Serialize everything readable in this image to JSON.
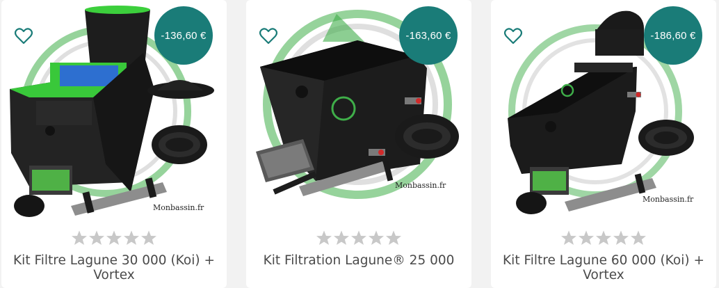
{
  "products": [
    {
      "title": "Kit Filtre Lagune 30 000 (Koi) + Vortex",
      "discount": "-136,60 €",
      "brand_mark": "Monbassin.fr",
      "rating": 0,
      "max_rating": 5
    },
    {
      "title": "Kit Filtration Lagune® 25 000",
      "discount": "-163,60 €",
      "brand_mark": "Monbassin.fr",
      "rating": 0,
      "max_rating": 5
    },
    {
      "title": "Kit Filtre Lagune 60 000 (Koi) + Vortex",
      "discount": "-186,60 €",
      "brand_mark": "Monbassin.fr",
      "rating": 0,
      "max_rating": 5
    }
  ],
  "colors": {
    "badge": "#1a7c78",
    "heart": "#1a7c78",
    "star_empty": "#c8c8c8",
    "title_text": "#4a4a4a"
  }
}
